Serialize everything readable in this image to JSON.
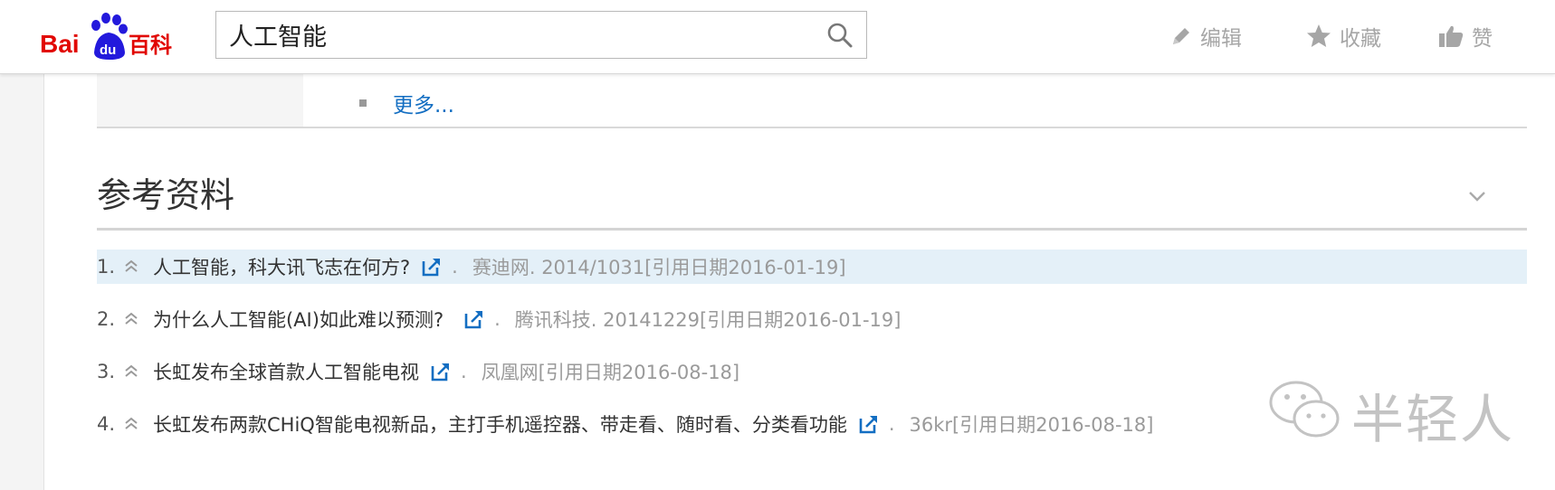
{
  "header": {
    "logo_text": "Bai du 百科",
    "search_value": "人工智能",
    "actions": [
      {
        "label": "编辑",
        "icon": "pencil-icon"
      },
      {
        "label": "收藏",
        "icon": "star-icon"
      },
      {
        "label": "赞",
        "icon": "thumbs-up-icon"
      }
    ]
  },
  "more": {
    "label": "更多..."
  },
  "section": {
    "title": "参考资料"
  },
  "references": [
    {
      "num": "1.",
      "title": "人工智能，科大讯飞志在何方?",
      "dot": ".",
      "source": "赛迪网. 2014/1031[引用日期2016-01-19]"
    },
    {
      "num": "2.",
      "title": "为什么人工智能(AI)如此难以预测?",
      "dot": ".",
      "source": "腾讯科技. 20141229[引用日期2016-01-19]"
    },
    {
      "num": "3.",
      "title": "长虹发布全球首款人工智能电视",
      "dot": ".",
      "source": "凤凰网[引用日期2016-08-18]"
    },
    {
      "num": "4.",
      "title": "长虹发布两款CHiQ智能电视新品，主打手机遥控器、带走看、随时看、分类看功能",
      "dot": ".",
      "source": "36kr[引用日期2016-08-18]"
    }
  ],
  "watermark": {
    "text": "半轻人"
  },
  "colors": {
    "link_blue": "#136ec2",
    "logo_red": "#e10601",
    "logo_blue": "#2319dc",
    "highlight": "#e4f0f8"
  }
}
